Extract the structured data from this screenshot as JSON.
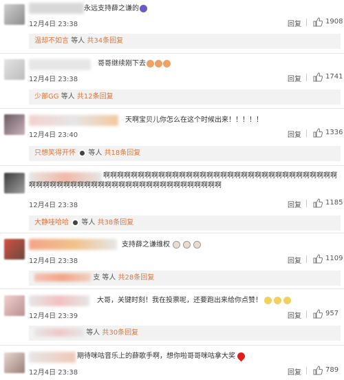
{
  "comments": [
    {
      "text": "永远支持薛之谦的",
      "time": "12月4日 23:38",
      "reply_label": "回复",
      "likes": "1908",
      "sub_nick": "温却不如言",
      "sub_mid": "等人",
      "sub_count": "共34条回复"
    },
    {
      "text": "哥哥继续刚下去",
      "time": "12月4日 23:38",
      "reply_label": "回复",
      "likes": "1741",
      "sub_nick": "少部GG",
      "sub_mid": "等人",
      "sub_count": "共12条回复"
    },
    {
      "text": "天啊宝贝儿你怎么在这个时候出来！！！！！",
      "time": "12月4日 23:40",
      "reply_label": "回复",
      "likes": "1336",
      "sub_nick": "只想笑得开怀",
      "sub_mid": "等人",
      "sub_count": "共18条回复"
    },
    {
      "text": "啊啊啊啊啊啊啊啊啊啊啊啊啊啊啊啊啊啊啊啊啊啊啊啊啊啊啊啊啊啊啊啊啊啊啊啊啊啊啊啊啊啊啊啊啊啊啊啊啊啊啊啊啊啊啊啊啊啊啊啊啊啊",
      "time": "12月4日 23:38",
      "reply_label": "回复",
      "likes": "1185",
      "sub_nick": "大静哇哈哈",
      "sub_mid": "等人",
      "sub_count": "共38条回复"
    },
    {
      "text": "支持薛之谦维权",
      "time": "12月4日 23:38",
      "reply_label": "回复",
      "likes": "1109",
      "sub_nick": "",
      "sub_mid": "支 等人",
      "sub_count": "共28条回复"
    },
    {
      "text": "大哥，关键时刻！我在投票呢，还要跑出来给你点赞！",
      "time": "12月4日 23:39",
      "reply_label": "回复",
      "likes": "957",
      "sub_nick": "",
      "sub_mid": "等人",
      "sub_count": "共30条回复"
    },
    {
      "text": "期待咪咕音乐上的薛歌手啊，想你啦哥哥咪咕拿大奖",
      "time": "12月4日 23:38",
      "reply_label": "回复",
      "likes": "789"
    }
  ]
}
